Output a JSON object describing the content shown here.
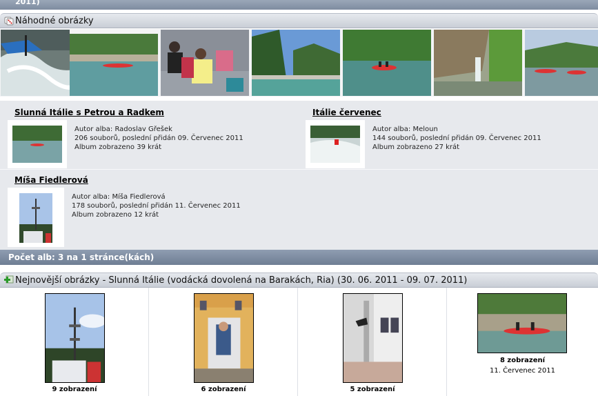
{
  "top_remnant": {
    "text": "2011)"
  },
  "random": {
    "title": "Náhodné obrázky",
    "icon": "dice-icon",
    "thumbs": [
      "rapids",
      "river-rafts",
      "group-people",
      "river-canyon",
      "raft-river",
      "cliff-waterfall",
      "rafts-lake"
    ]
  },
  "albums": [
    {
      "title": "Slunná Itálie s Petrou a Radkem",
      "author": "Autor alba: Radoslav Gřešek",
      "files": "206 souborů, poslední přidán 09. Červenec 2011",
      "views": "Album zobrazeno 39 krát"
    },
    {
      "title": "Itálie červenec",
      "author": "Autor alba: Meloun",
      "files": "144 souborů, poslední přidán 09. Červenec 2011",
      "views": "Album zobrazeno 27 krát"
    },
    {
      "title": "Míša Fiedlerová",
      "author": "Autor alba: Míša Fiedlerová",
      "files": "178 souborů, poslední přidán 11. Červenec 2011",
      "views": "Album zobrazeno 12 krát"
    }
  ],
  "count_bar": {
    "text": "Počet alb: 3 na 1 stránce(kách)"
  },
  "latest": {
    "title": "Nejnovější obrázky - Slunná Itálie (vodácká dovolená na Barakách, Ria) (30. 06. 2011 - 09. 07. 2011)",
    "icon": "plus-image-icon",
    "items": [
      {
        "views": "9 zobrazení",
        "date": ""
      },
      {
        "views": "6 zobrazení",
        "date": ""
      },
      {
        "views": "5 zobrazení",
        "date": ""
      },
      {
        "views": "8 zobrazení",
        "date": "11. Červenec 2011"
      }
    ]
  },
  "colors": {
    "header_dark": "#7e8ca0",
    "header_light": "#d5d9e0",
    "album_bg": "#e7e9ed"
  }
}
